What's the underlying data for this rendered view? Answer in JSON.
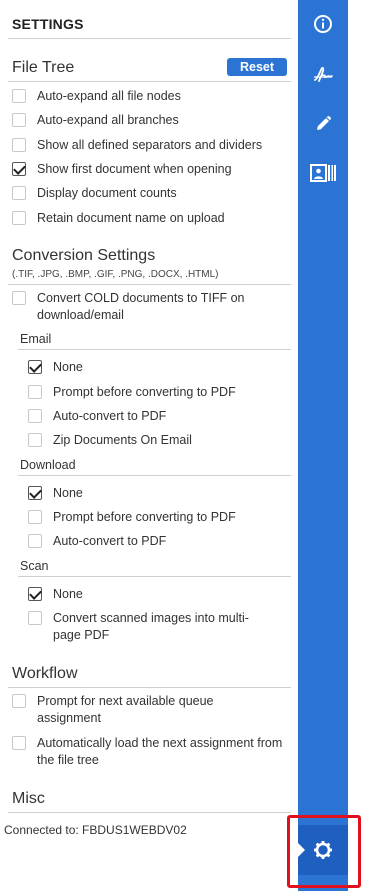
{
  "header": {
    "title": "SETTINGS"
  },
  "file_tree": {
    "title": "File Tree",
    "reset_label": "Reset",
    "options": [
      {
        "label": "Auto-expand all file nodes",
        "checked": false
      },
      {
        "label": "Auto-expand all branches",
        "checked": false
      },
      {
        "label": "Show all defined separators and dividers",
        "checked": false
      },
      {
        "label": "Show first document when opening",
        "checked": true
      },
      {
        "label": "Display document counts",
        "checked": false
      },
      {
        "label": "Retain document name on upload",
        "checked": false
      }
    ]
  },
  "conversion": {
    "title": "Conversion Settings",
    "subtitle": "(.TIF, .JPG, .BMP, .GIF, .PNG, .DOCX, .HTML)",
    "cold_option": {
      "label": "Convert COLD documents to TIFF on download/email",
      "checked": false
    },
    "email": {
      "label": "Email",
      "options": [
        {
          "label": "None",
          "checked": true
        },
        {
          "label": "Prompt before converting to PDF",
          "checked": false
        },
        {
          "label": "Auto-convert to PDF",
          "checked": false
        },
        {
          "label": "Zip Documents On Email",
          "checked": false
        }
      ]
    },
    "download": {
      "label": "Download",
      "options": [
        {
          "label": "None",
          "checked": true
        },
        {
          "label": "Prompt before converting to PDF",
          "checked": false
        },
        {
          "label": "Auto-convert to PDF",
          "checked": false
        }
      ]
    },
    "scan": {
      "label": "Scan",
      "options": [
        {
          "label": "None",
          "checked": true
        },
        {
          "label": "Convert scanned images into multi-page PDF",
          "checked": false
        }
      ]
    }
  },
  "workflow": {
    "title": "Workflow",
    "options": [
      {
        "label": "Prompt for next available queue assignment",
        "checked": false
      },
      {
        "label": "Automatically load the next assignment from the file tree",
        "checked": false
      }
    ]
  },
  "misc": {
    "title": "Misc"
  },
  "status": {
    "connected": "Connected to: FBDUS1WEBDV02"
  },
  "sidebar": {
    "items": [
      {
        "icon": "info-icon"
      },
      {
        "icon": "signature-icon"
      },
      {
        "icon": "pencil-icon"
      },
      {
        "icon": "barcode-card-icon"
      }
    ],
    "active": {
      "icon": "gear-icon"
    }
  },
  "colors": {
    "accent": "#2b74d4",
    "accent_dark": "#1f5fc0",
    "highlight": "#e0101c"
  }
}
